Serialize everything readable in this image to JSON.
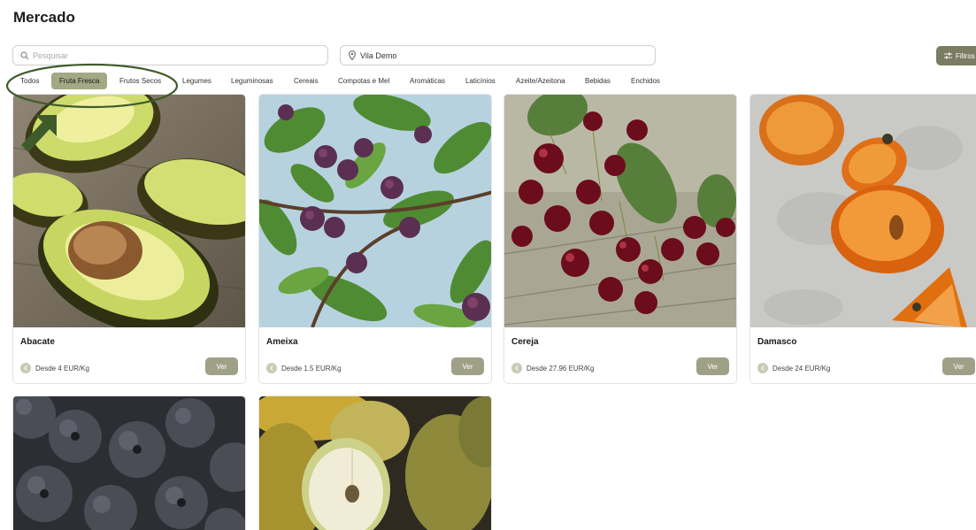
{
  "page": {
    "title": "Mercado"
  },
  "search": {
    "placeholder": "Pesquisar",
    "value": ""
  },
  "location": {
    "value": "Vila Demo"
  },
  "filters": {
    "label": "Filtros"
  },
  "categories": [
    {
      "label": "Todos",
      "active": false
    },
    {
      "label": "Fruta Fresca",
      "active": true
    },
    {
      "label": "Frutos Secos",
      "active": false
    },
    {
      "label": "Legumes",
      "active": false
    },
    {
      "label": "Leguminosas",
      "active": false
    },
    {
      "label": "Cereais",
      "active": false
    },
    {
      "label": "Compotas e Mel",
      "active": false
    },
    {
      "label": "Aromáticas",
      "active": false
    },
    {
      "label": "Laticínios",
      "active": false
    },
    {
      "label": "Azeite/Azeitona",
      "active": false
    },
    {
      "label": "Bebidas",
      "active": false
    },
    {
      "label": "Enchidos",
      "active": false
    }
  ],
  "products": [
    {
      "name": "Abacate",
      "price": "Desde 4 EUR/Kg",
      "action": "Ver",
      "image": "avocado"
    },
    {
      "name": "Ameixa",
      "price": "Desde 1.5 EUR/Kg",
      "action": "Ver",
      "image": "plum"
    },
    {
      "name": "Cereja",
      "price": "Desde 27.96 EUR/Kg",
      "action": "Ver",
      "image": "cherry"
    },
    {
      "name": "Damasco",
      "price": "Desde 24 EUR/Kg",
      "action": "Ver",
      "image": "apricot"
    },
    {
      "name": "",
      "price": "",
      "action": "",
      "image": "blueberry"
    },
    {
      "name": "",
      "price": "",
      "action": "",
      "image": "pear"
    }
  ],
  "colors": {
    "accent": "#7b7d63",
    "chip_active": "#a3a885",
    "annotation": "#3f5b2a"
  }
}
